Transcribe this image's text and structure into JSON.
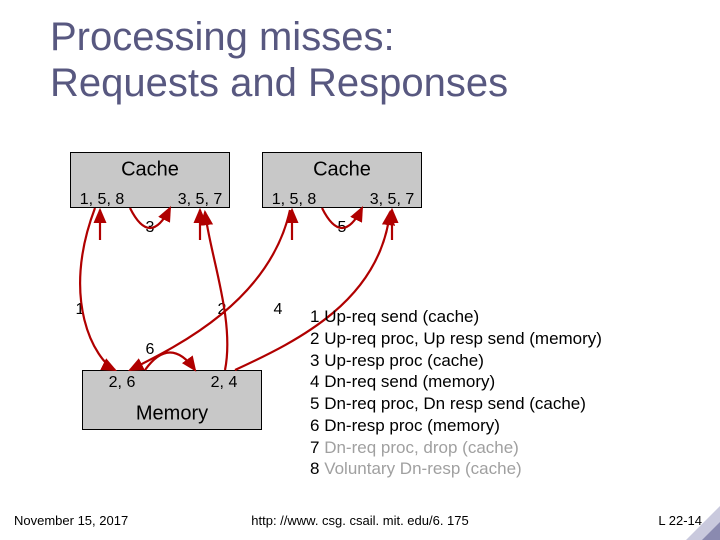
{
  "title_line1": "Processing misses:",
  "title_line2": "Requests and Responses",
  "cache1": {
    "title": "Cache",
    "left": "1, 5, 8",
    "right": "3, 5, 7",
    "below": "3"
  },
  "cache2": {
    "title": "Cache",
    "left": "1, 5, 8",
    "right": "3, 5, 7",
    "below": "5"
  },
  "memory": {
    "title": "Memory",
    "left": "2, 6",
    "right": "2, 4"
  },
  "arrow_labels": {
    "one": "1",
    "two": "2",
    "four": "4",
    "six": "6"
  },
  "legend": [
    {
      "n": "1",
      "text": "Up-req send (cache)",
      "gray": false
    },
    {
      "n": "2",
      "text": "Up-req proc, Up resp send (memory)",
      "gray": false
    },
    {
      "n": "3",
      "text": "Up-resp proc (cache)",
      "gray": false
    },
    {
      "n": "4",
      "text": "Dn-req send (memory)",
      "gray": false
    },
    {
      "n": "5",
      "text": "Dn-req proc, Dn resp send (cache)",
      "gray": false
    },
    {
      "n": "6",
      "text": "Dn-resp proc (memory)",
      "gray": false
    },
    {
      "n": "7",
      "text": "Dn-req proc, drop (cache)",
      "gray": true
    },
    {
      "n": "8",
      "text": "Voluntary Dn-resp (cache)",
      "gray": true
    }
  ],
  "footer": {
    "date": "November 15, 2017",
    "url": "http: //www. csg. csail. mit. edu/6. 175",
    "page": "L 22-14"
  }
}
